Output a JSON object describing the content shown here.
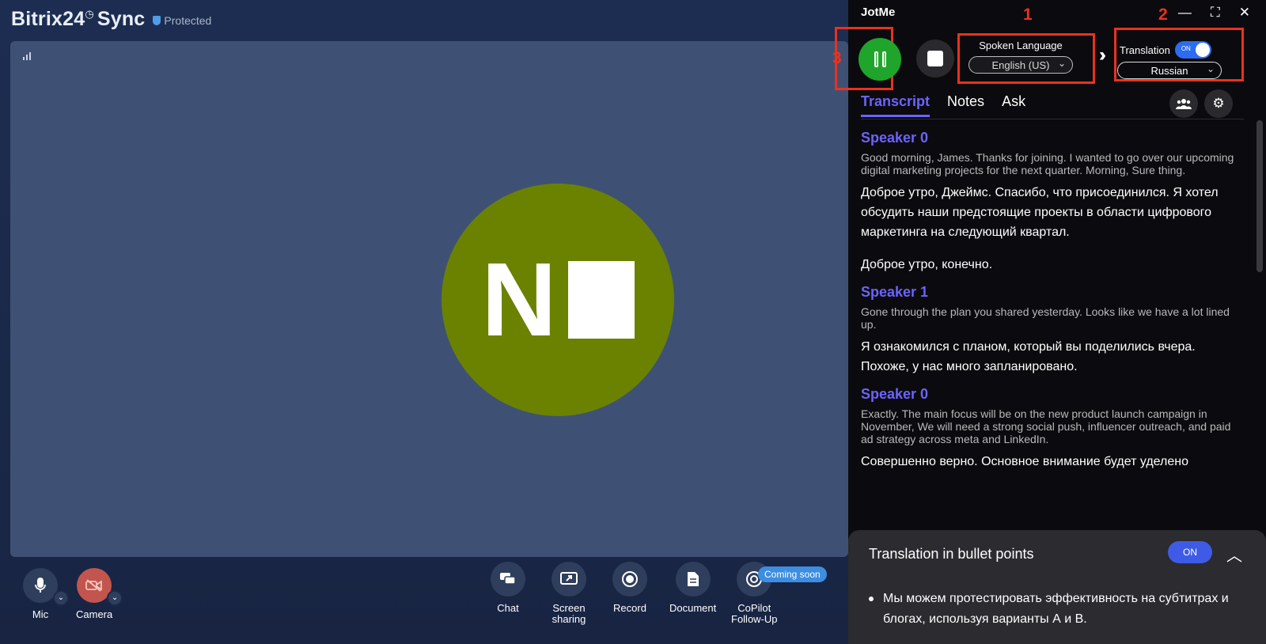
{
  "bitrix": {
    "logo_text": "Bitrix24",
    "logo_suffix": "Sync",
    "protected_label": "Protected",
    "participant_initial": "N",
    "toolbar": {
      "mic_label": "Mic",
      "camera_label": "Camera",
      "chat_label": "Chat",
      "screen_label_1": "Screen",
      "screen_label_2": "sharing",
      "record_label": "Record",
      "document_label": "Document",
      "copilot_label_1": "CoPilot",
      "copilot_label_2": "Follow-Up",
      "coming_soon_badge": "Coming soon"
    },
    "colors": {
      "avatar": "#6a8200",
      "camera_off": "#c2554d"
    }
  },
  "jotme": {
    "app_title": "JotMe",
    "annotations": [
      "1",
      "2",
      "3"
    ],
    "spoken_language": {
      "label": "Spoken Language",
      "value": "English (US)"
    },
    "translation": {
      "label": "Translation",
      "toggle_text": "ON",
      "value": "Russian"
    },
    "tabs": [
      {
        "label": "Transcript",
        "active": true
      },
      {
        "label": "Notes",
        "active": false
      },
      {
        "label": "Ask",
        "active": false
      }
    ],
    "transcript": [
      {
        "speaker": "Speaker 0",
        "original": "Good morning, James. Thanks for joining. I wanted to go over our upcoming digital marketing projects for the next quarter. Morning, Sure thing.",
        "translation": "Доброе утро, Джеймс. Спасибо, что присоединился. Я хотел обсудить наши предстоящие проекты в области цифрового маркетинга на следующий квартал.",
        "translation_2": "Доброе утро, конечно."
      },
      {
        "speaker": "Speaker 1",
        "original": "Gone through the plan you shared yesterday. Looks like we have a lot lined up.",
        "translation": "Я ознакомился с планом, который вы поделились вчера. Похоже, у нас много запланировано."
      },
      {
        "speaker": "Speaker 0",
        "original": "Exactly. The main focus will be on the new product launch campaign in November, We will need a strong social push, influencer outreach, and paid ad strategy across meta and LinkedIn.",
        "translation": "Совершенно верно. Основное внимание будет уделено"
      }
    ],
    "bullets_panel": {
      "title": "Translation in bullet points",
      "toggle_text": "ON",
      "items": [
        "Мы можем протестировать эффективность на субтитрах и блогах, используя варианты А и В."
      ]
    },
    "colors": {
      "accent": "#6c63ff",
      "record_green": "#1fa52b",
      "annotation_red": "#e8321f",
      "toggle_blue": "#2c6cf0"
    }
  }
}
